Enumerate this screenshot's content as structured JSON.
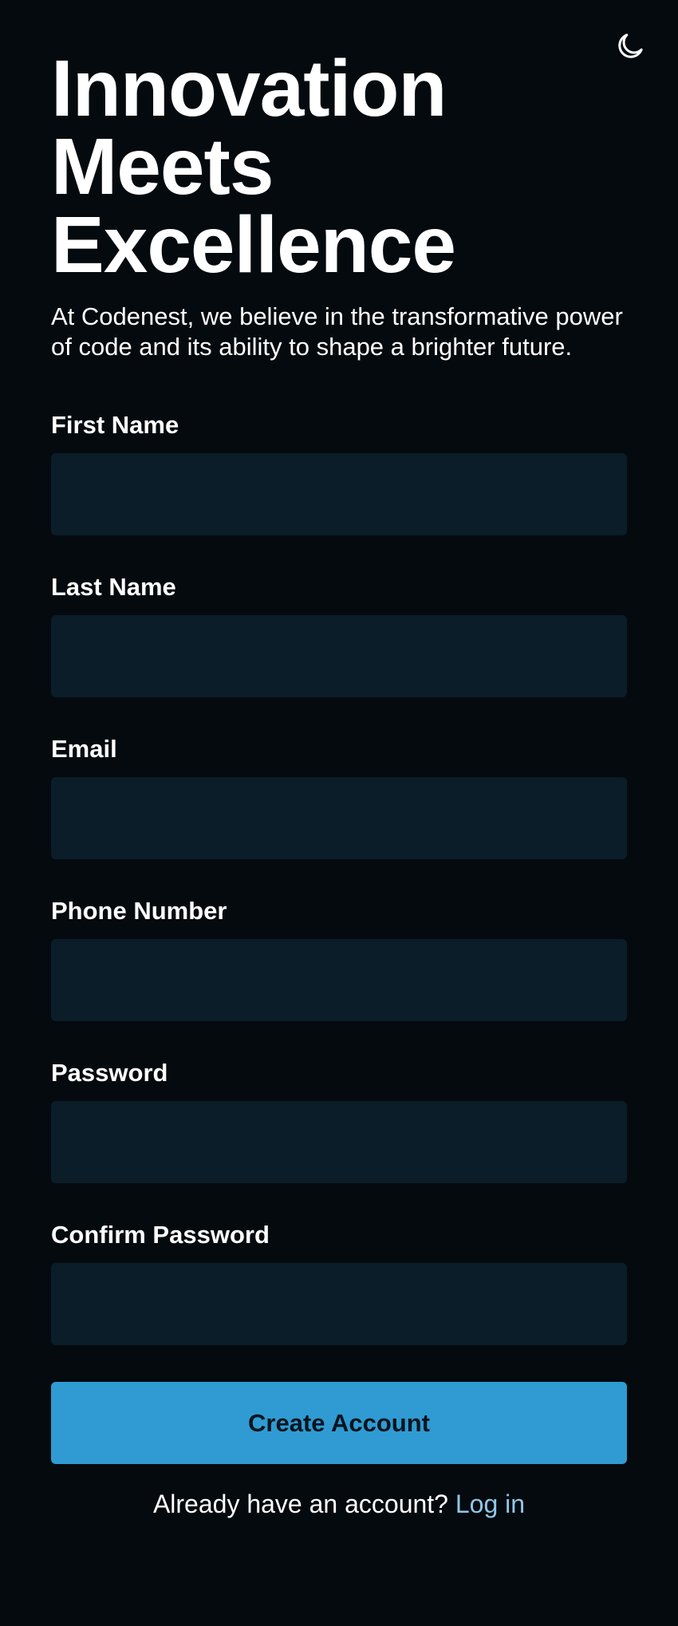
{
  "theme": {
    "toggle_icon": "moon-icon"
  },
  "hero": {
    "title_lines": [
      "Innovation",
      "Meets",
      "Excellence"
    ],
    "subtitle": "At Codenest, we believe in the transformative power of code and its ability to shape a brighter future."
  },
  "form": {
    "fields": [
      {
        "label": "First Name",
        "value": "",
        "placeholder": ""
      },
      {
        "label": "Last Name",
        "value": "",
        "placeholder": ""
      },
      {
        "label": "Email",
        "value": "",
        "placeholder": ""
      },
      {
        "label": "Phone Number",
        "value": "",
        "placeholder": ""
      },
      {
        "label": "Password",
        "value": "",
        "placeholder": ""
      },
      {
        "label": "Confirm Password",
        "value": "",
        "placeholder": ""
      }
    ],
    "submit_label": "Create Account"
  },
  "footer": {
    "prompt": "Already have an account?",
    "link_label": "Log in"
  },
  "colors": {
    "background": "#050a0e",
    "input_background": "#0a1d29",
    "accent": "#2f9bd2",
    "link": "#8fc7ea"
  }
}
